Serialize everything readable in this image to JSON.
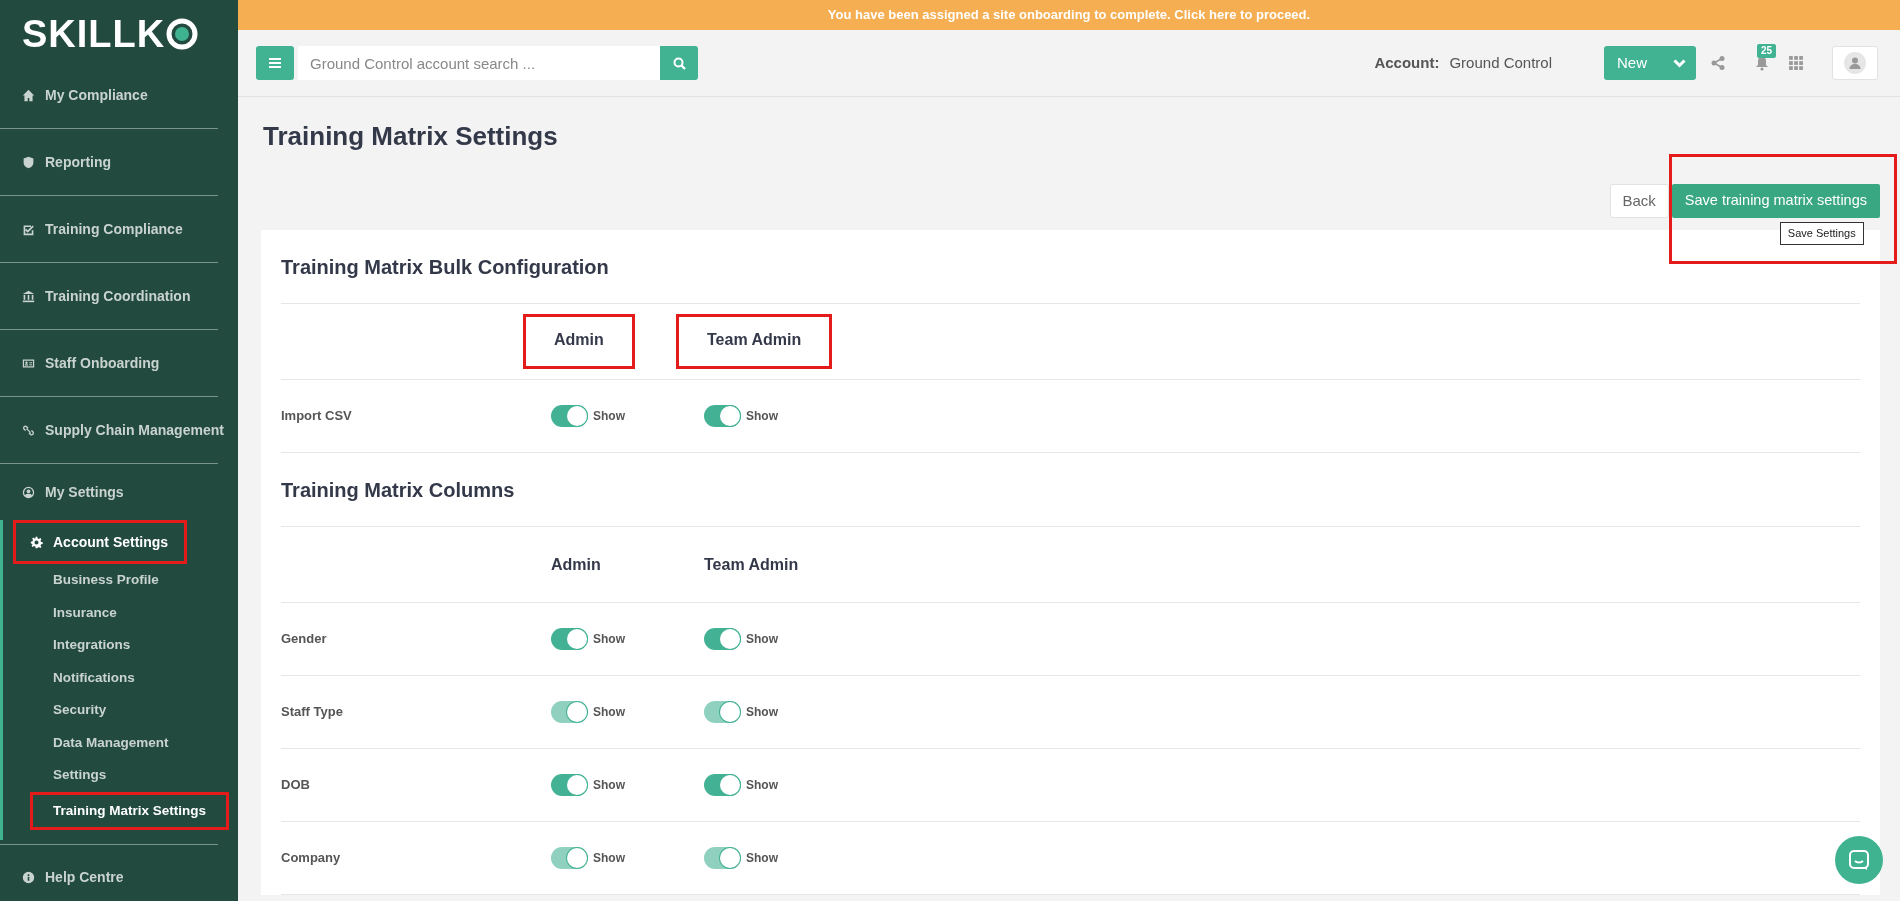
{
  "banner": {
    "text": "You have been assigned a site onboarding to complete. Click here to proceed."
  },
  "sidebar": {
    "logo": "SKILLK",
    "items": [
      {
        "label": "My Compliance",
        "kind": "home",
        "selected": false,
        "highlighted": false
      },
      {
        "label": "Reporting",
        "kind": "shield",
        "selected": false,
        "highlighted": false
      },
      {
        "label": "Training Compliance",
        "kind": "check",
        "selected": false,
        "highlighted": false
      },
      {
        "label": "Training Coordination",
        "kind": "bank",
        "selected": false,
        "highlighted": false
      },
      {
        "label": "Staff Onboarding",
        "kind": "card",
        "selected": false,
        "highlighted": false
      },
      {
        "label": "Supply Chain Management",
        "kind": "link",
        "selected": false,
        "highlighted": false
      },
      {
        "label": "My Settings",
        "kind": "user",
        "selected": false,
        "highlighted": false
      },
      {
        "label": "Account Settings",
        "kind": "gear",
        "selected": true,
        "highlighted": true,
        "children": [
          {
            "label": "Business Profile",
            "selected": false,
            "highlighted": false
          },
          {
            "label": "Insurance",
            "selected": false,
            "highlighted": false
          },
          {
            "label": "Integrations",
            "selected": false,
            "highlighted": false
          },
          {
            "label": "Notifications",
            "selected": false,
            "highlighted": false
          },
          {
            "label": "Security",
            "selected": false,
            "highlighted": false
          },
          {
            "label": "Data Management",
            "selected": false,
            "highlighted": false
          },
          {
            "label": "Settings",
            "selected": false,
            "highlighted": false
          },
          {
            "label": "Training Matrix Settings",
            "selected": true,
            "highlighted": true
          }
        ]
      },
      {
        "label": "Help Centre",
        "kind": "info",
        "selected": false,
        "highlighted": false
      }
    ]
  },
  "topbar": {
    "search": {
      "placeholder": "Ground Control account search ..."
    },
    "account_label": "Account:",
    "account_name": "Ground Control",
    "new_button": "New",
    "notification_count": "25"
  },
  "page": {
    "title": "Training Matrix Settings",
    "back_button": "Back",
    "save_button": {
      "label": "Save training matrix settings",
      "highlighted": true,
      "tooltip": "Save Settings"
    },
    "sections": [
      {
        "title": "Training Matrix Bulk Configuration",
        "columns": [
          {
            "label": "Admin",
            "highlighted": true
          },
          {
            "label": "Team Admin",
            "highlighted": true
          }
        ],
        "rows": [
          {
            "label": "Import CSV",
            "toggles": [
              {
                "on": true,
                "disabled": false,
                "label": "Show"
              },
              {
                "on": true,
                "disabled": false,
                "label": "Show"
              }
            ]
          }
        ]
      },
      {
        "title": "Training Matrix Columns",
        "columns": [
          {
            "label": "Admin",
            "highlighted": false
          },
          {
            "label": "Team Admin",
            "highlighted": false
          }
        ],
        "rows": [
          {
            "label": "Gender",
            "toggles": [
              {
                "on": true,
                "disabled": false,
                "label": "Show"
              },
              {
                "on": true,
                "disabled": false,
                "label": "Show"
              }
            ]
          },
          {
            "label": "Staff Type",
            "toggles": [
              {
                "on": true,
                "disabled": true,
                "label": "Show"
              },
              {
                "on": true,
                "disabled": true,
                "label": "Show"
              }
            ]
          },
          {
            "label": "DOB",
            "toggles": [
              {
                "on": true,
                "disabled": false,
                "label": "Show"
              },
              {
                "on": true,
                "disabled": false,
                "label": "Show"
              }
            ]
          },
          {
            "label": "Company",
            "toggles": [
              {
                "on": true,
                "disabled": true,
                "label": "Show"
              },
              {
                "on": true,
                "disabled": true,
                "label": "Show"
              }
            ]
          }
        ]
      }
    ]
  }
}
